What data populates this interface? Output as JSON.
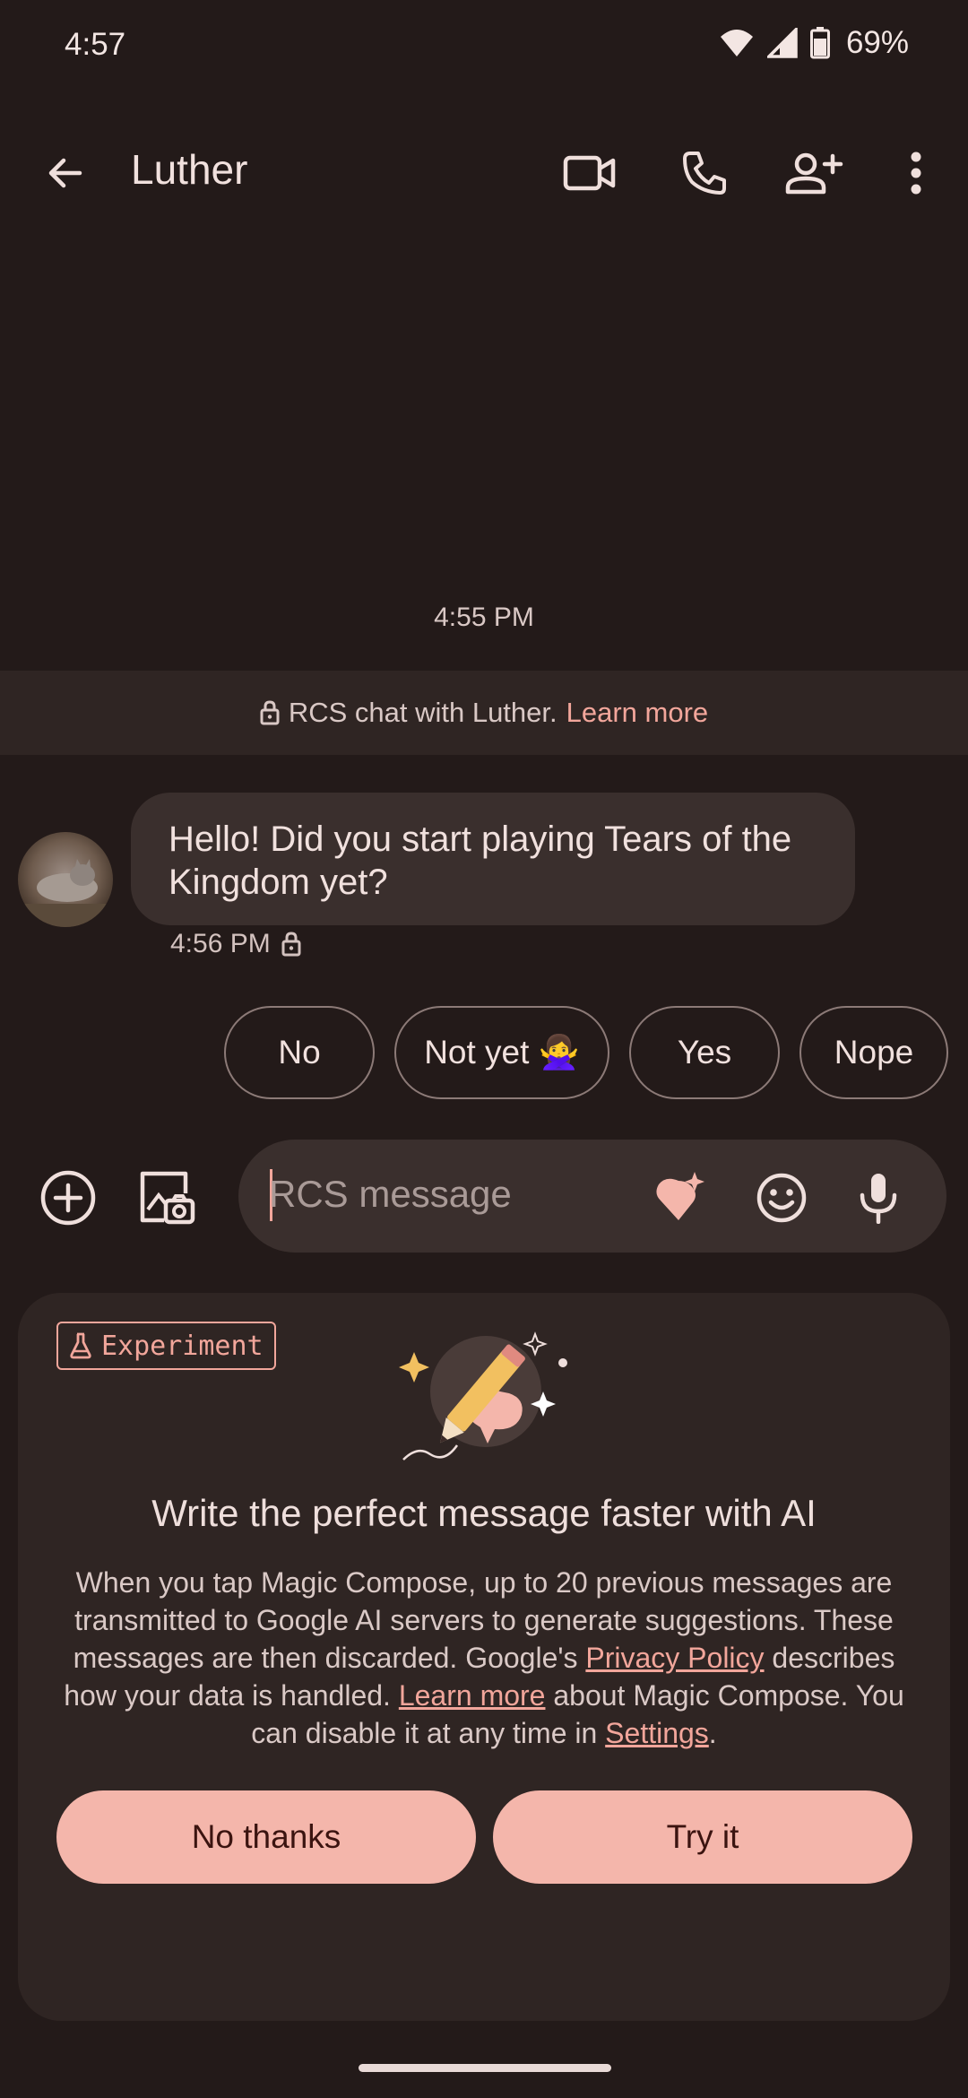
{
  "status_bar": {
    "time": "4:57",
    "battery": "69%"
  },
  "app_bar": {
    "contact_name": "Luther",
    "icons": [
      "back-arrow-icon",
      "video-call-icon",
      "phone-icon",
      "add-person-icon",
      "more-vert-icon"
    ]
  },
  "conversation": {
    "timestamp": "4:55 PM",
    "rcs_banner_text": "RCS chat with Luther.",
    "rcs_banner_link": "Learn more",
    "message": {
      "text": "Hello! Did you start playing Tears of the Kingdom yet?",
      "time": "4:56 PM"
    },
    "smart_replies": [
      "No",
      "Not yet 🙅‍♀️",
      "Yes",
      "Nope"
    ]
  },
  "compose": {
    "placeholder": "RCS message"
  },
  "magic_compose_card": {
    "badge": "Experiment",
    "title": "Write the perfect message faster with AI",
    "body_1": "When you tap Magic Compose, up to 20 previous messages are transmitted to Google AI servers to generate suggestions. These messages are then discarded. Google's ",
    "privacy_link": "Privacy Policy",
    "body_2": " describes how your data is handled. ",
    "learn_more_link": "Learn more",
    "body_3": " about Magic Compose. You can disable it at any time in ",
    "settings_link": "Settings",
    "body_4": ".",
    "no_thanks": "No thanks",
    "try_it": "Try it"
  },
  "colors": {
    "background": "#231a19",
    "accent": "#f2a69b",
    "button": "#f4b6ab",
    "bubble": "#3a2f2d"
  }
}
